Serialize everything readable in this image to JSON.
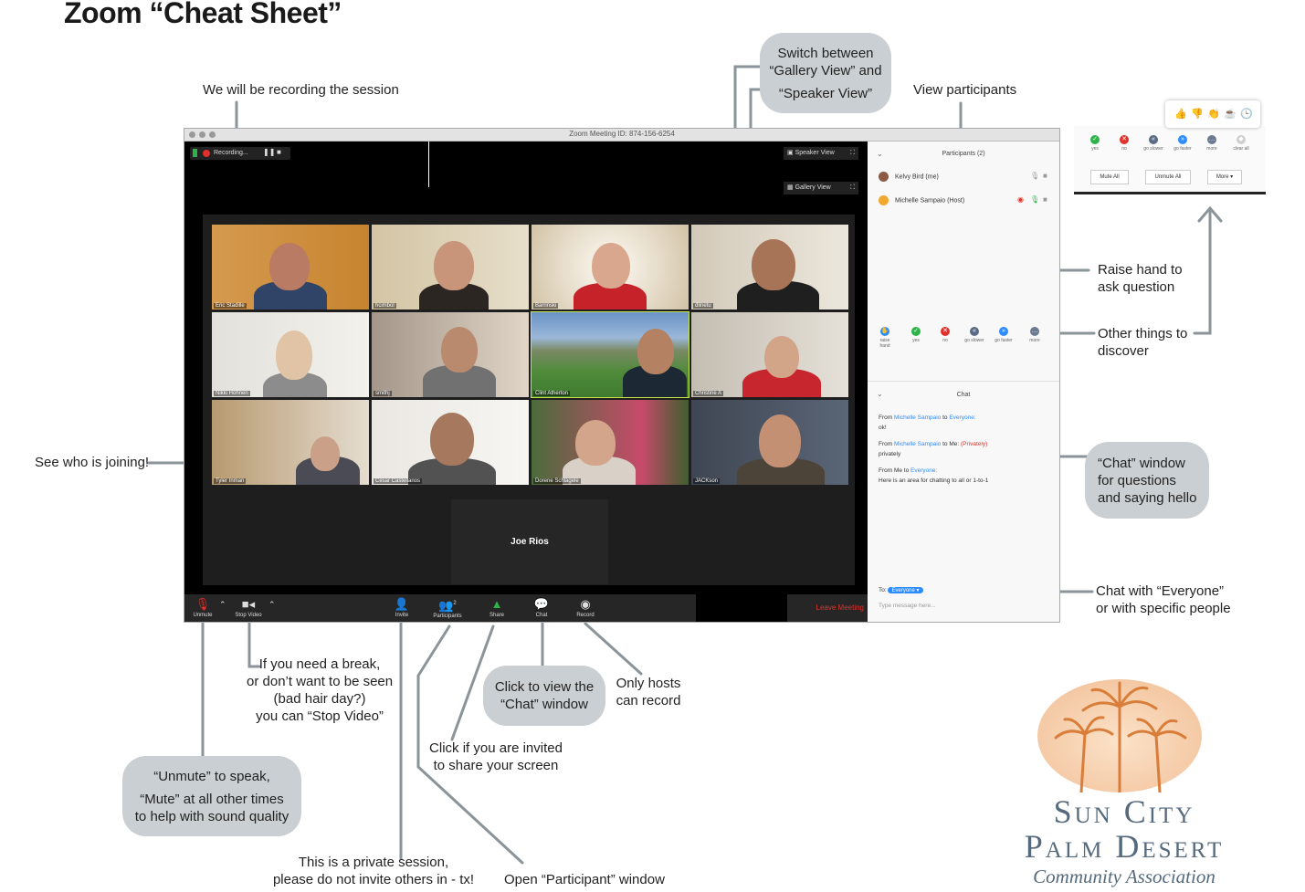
{
  "page_title": "Zoom “Cheat Sheet”",
  "window": {
    "title": "Zoom Meeting ID: 874-156-6254",
    "recording_label": "Recording...",
    "speaker_view_label": "Speaker View",
    "gallery_view_label": "Gallery View",
    "participant_names": [
      "Eric Stadille",
      "hcimbol",
      "Barrinski",
      "dlinetu",
      "Nikki Hohnen",
      "smithj",
      "Clint Atherton",
      "Christine A",
      "Tyler Inman",
      "Cesar Castellanos",
      "Dorene Schlagele",
      "JACKson"
    ],
    "active_speaker": "Joe Rios",
    "toolbar": {
      "unmute": "Unmute",
      "stop_video": "Stop Video",
      "invite": "Invite",
      "participants": "Participants",
      "participants_count": "2",
      "share": "Share",
      "chat": "Chat",
      "record": "Record",
      "leave": "Leave Meeting"
    },
    "sidebar": {
      "participants_header": "Participants (2)",
      "participants": [
        "Kelvy Bird (me)",
        "Michelle Sampaio (Host)"
      ],
      "reactions": [
        "raise hand",
        "yes",
        "no",
        "go slower",
        "go faster",
        "more"
      ],
      "chat_header": "Chat",
      "messages": [
        {
          "from": "From",
          "sender": "Michelle Sampaio",
          "to": "to",
          "recipient": "Everyone:",
          "text": "ok!",
          "private": ""
        },
        {
          "from": "From",
          "sender": "Michelle Sampaio",
          "to": "to Me:",
          "recipient": "",
          "text": "privately",
          "private": "(Privately)"
        },
        {
          "from": "From Me to",
          "sender": "",
          "to": "",
          "recipient": "Everyone:",
          "text": "Here is an area for chatting to all or 1-to-1",
          "private": ""
        }
      ],
      "to_label": "To:",
      "to_value": "Everyone",
      "input_placeholder": "Type message here..."
    }
  },
  "panel": {
    "reactions": [
      "yes",
      "no",
      "go slower",
      "go faster",
      "more",
      "clear all"
    ],
    "buttons": [
      "Mute All",
      "Unmute All",
      "More"
    ]
  },
  "callouts": {
    "recording": "We will be recording the session",
    "switch_view_1": "Switch between",
    "switch_view_2": "“Gallery View” and",
    "switch_view_3": "“Speaker View”",
    "view_participants": "View participants",
    "raise_hand_1": "Raise hand to",
    "raise_hand_2": "ask question",
    "other_things_1": "Other things to",
    "other_things_2": "discover",
    "see_joining": "See who is joining!",
    "chat_window_1": "“Chat” window",
    "chat_window_2": "for questions",
    "chat_window_3": "and saying hello",
    "chat_everyone_1": "Chat with “Everyone”",
    "chat_everyone_2": "or with specific people",
    "break_1": "If you need a break,",
    "break_2": "or don’t want to be seen",
    "break_3": "(bad hair day?)",
    "break_4": "you can “Stop Video”",
    "click_chat_1": "Click to view the",
    "click_chat_2": "“Chat” window",
    "hosts_1": "Only hosts",
    "hosts_2": "can record",
    "share_1": "Click if you are invited",
    "share_2": "to share your screen",
    "unmute_1": "“Unmute” to speak,",
    "unmute_2": "“Mute” at all other times",
    "unmute_3": "to help with sound quality",
    "private_1": "This is a private session,",
    "private_2": "please do not invite others in - tx!",
    "open_participant": "Open “Participant” window"
  },
  "logo": {
    "line1": "Sun City",
    "line2": "Palm Desert",
    "line3": "Community Association"
  },
  "colors": {
    "callout_bubble": "#c9cfd2",
    "leader_line": "#8a9499",
    "zoom_blue": "#2d8cff",
    "leave_red": "#e0302a",
    "logo_text": "#556a7d",
    "logo_palm": "#e8a77d"
  }
}
